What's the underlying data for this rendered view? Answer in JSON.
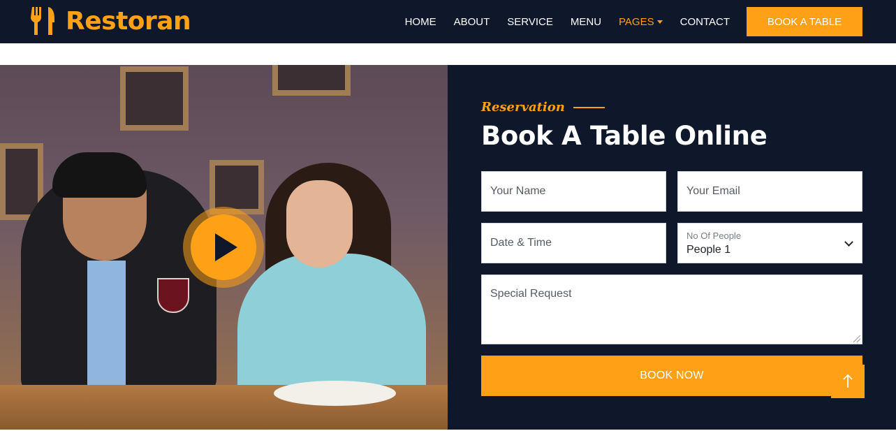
{
  "brand": {
    "name": "Restoran",
    "icon": "utensils-icon"
  },
  "nav": {
    "items": [
      {
        "label": "HOME"
      },
      {
        "label": "ABOUT"
      },
      {
        "label": "SERVICE"
      },
      {
        "label": "MENU"
      },
      {
        "label": "PAGES",
        "active": true,
        "dropdown": true
      },
      {
        "label": "CONTACT"
      }
    ],
    "cta_label": "BOOK A TABLE"
  },
  "video": {
    "play_icon": "play-icon"
  },
  "reservation": {
    "section_label": "Reservation",
    "heading": "Book A Table Online",
    "fields": {
      "name_placeholder": "Your Name",
      "email_placeholder": "Your Email",
      "datetime_placeholder": "Date & Time",
      "people_label": "No Of People",
      "people_value": "People 1",
      "request_placeholder": "Special Request"
    },
    "submit_label": "BOOK NOW"
  },
  "back_to_top_icon": "arrow-up-icon",
  "colors": {
    "primary": "#fea116",
    "dark": "#0f172b",
    "white": "#ffffff"
  }
}
